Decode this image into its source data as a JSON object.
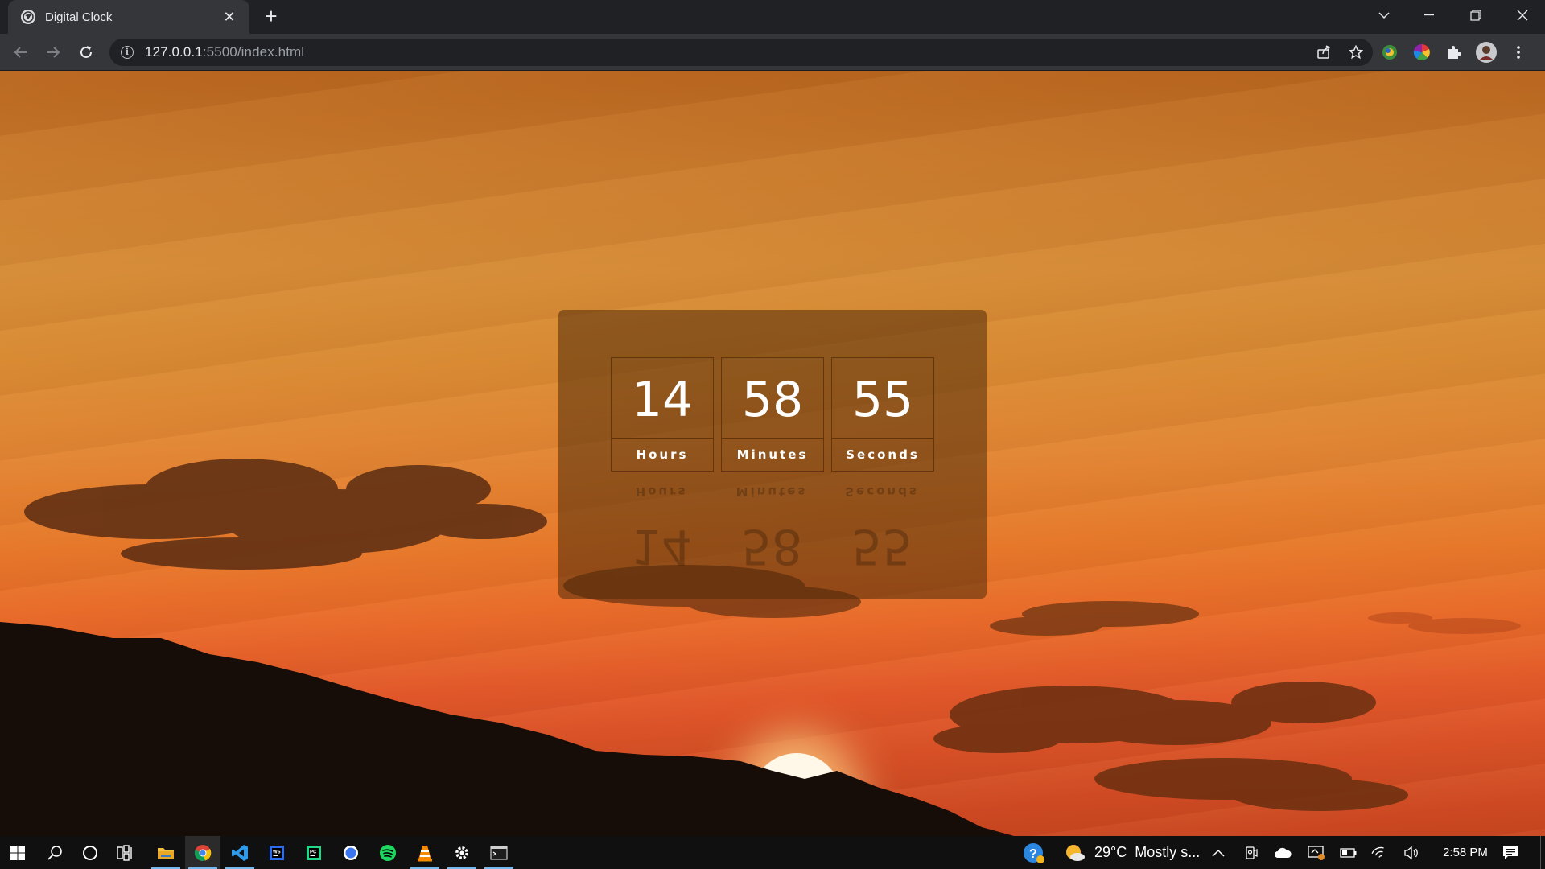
{
  "browser": {
    "tab": {
      "title": "Digital Clock"
    },
    "address": {
      "url_host": "127.0.0.1",
      "url_rest": ":5500/index.html"
    }
  },
  "clock": {
    "units": [
      {
        "value": "14",
        "label": "Hours"
      },
      {
        "value": "58",
        "label": "Minutes"
      },
      {
        "value": "55",
        "label": "Seconds"
      }
    ]
  },
  "taskbar": {
    "apps": [
      "windows-start",
      "search",
      "cortana",
      "task-view",
      "file-explorer",
      "chrome",
      "vscode",
      "jetbrains-webstorm",
      "jetbrains-pycharm",
      "signal",
      "spotify",
      "vlc",
      "settings",
      "terminal"
    ],
    "weather": {
      "temperature": "29°C",
      "condition": "Mostly s..."
    },
    "time": "2:58 PM"
  },
  "colors": {
    "chrome_dark": "#202124",
    "chrome_toolbar": "#35363a",
    "taskbar": "#101010",
    "accent_running": "#76b9ed"
  }
}
